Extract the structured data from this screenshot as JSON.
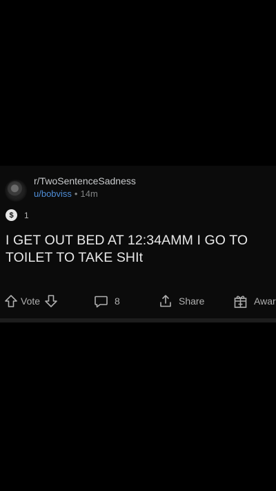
{
  "post": {
    "subreddit": "r/TwoSentenceSadness",
    "username": "u/bobviss",
    "separator": "•",
    "age": "14m",
    "award_badge": "$",
    "award_count": "1",
    "title_line1": "I GET OUT BED AT 12:34AMM I GO TO",
    "title_line2": "TOILET TO TAKE SHIt"
  },
  "actions": {
    "vote_label": "Vote",
    "comment_count": "8",
    "share_label": "Share",
    "award_label": "Awar"
  },
  "colors": {
    "background": "#000000",
    "card": "#0b0b0b",
    "username": "#4f8ed8",
    "text": "#e8e8e8",
    "muted": "#818384"
  }
}
